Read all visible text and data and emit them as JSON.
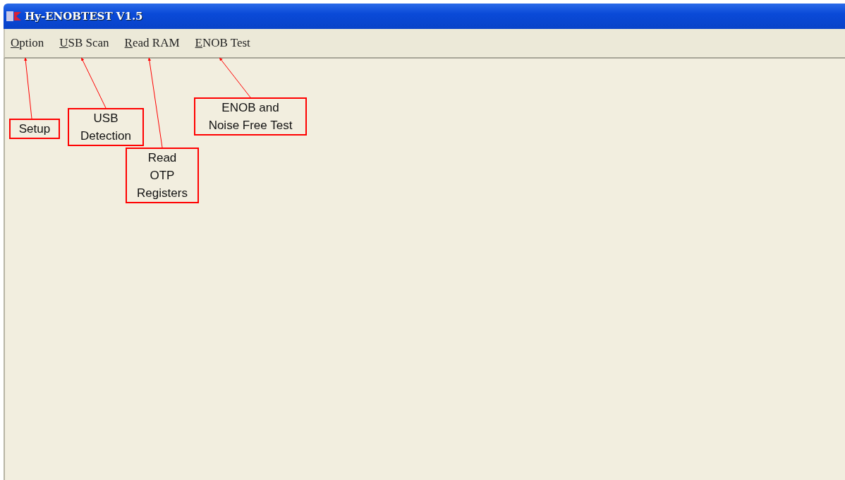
{
  "window": {
    "title": "Hy-ENOBTEST V1.5"
  },
  "menu": [
    {
      "label": "Option"
    },
    {
      "label": "USB Scan"
    },
    {
      "label": "Read RAM"
    },
    {
      "label": "ENOB Test"
    }
  ],
  "callouts": [
    {
      "text": "Setup"
    },
    {
      "text": "USB\nDetection"
    },
    {
      "text": "Read\nOTP\nRegisters"
    },
    {
      "text": "ENOB and\nNoise Free Test"
    }
  ]
}
